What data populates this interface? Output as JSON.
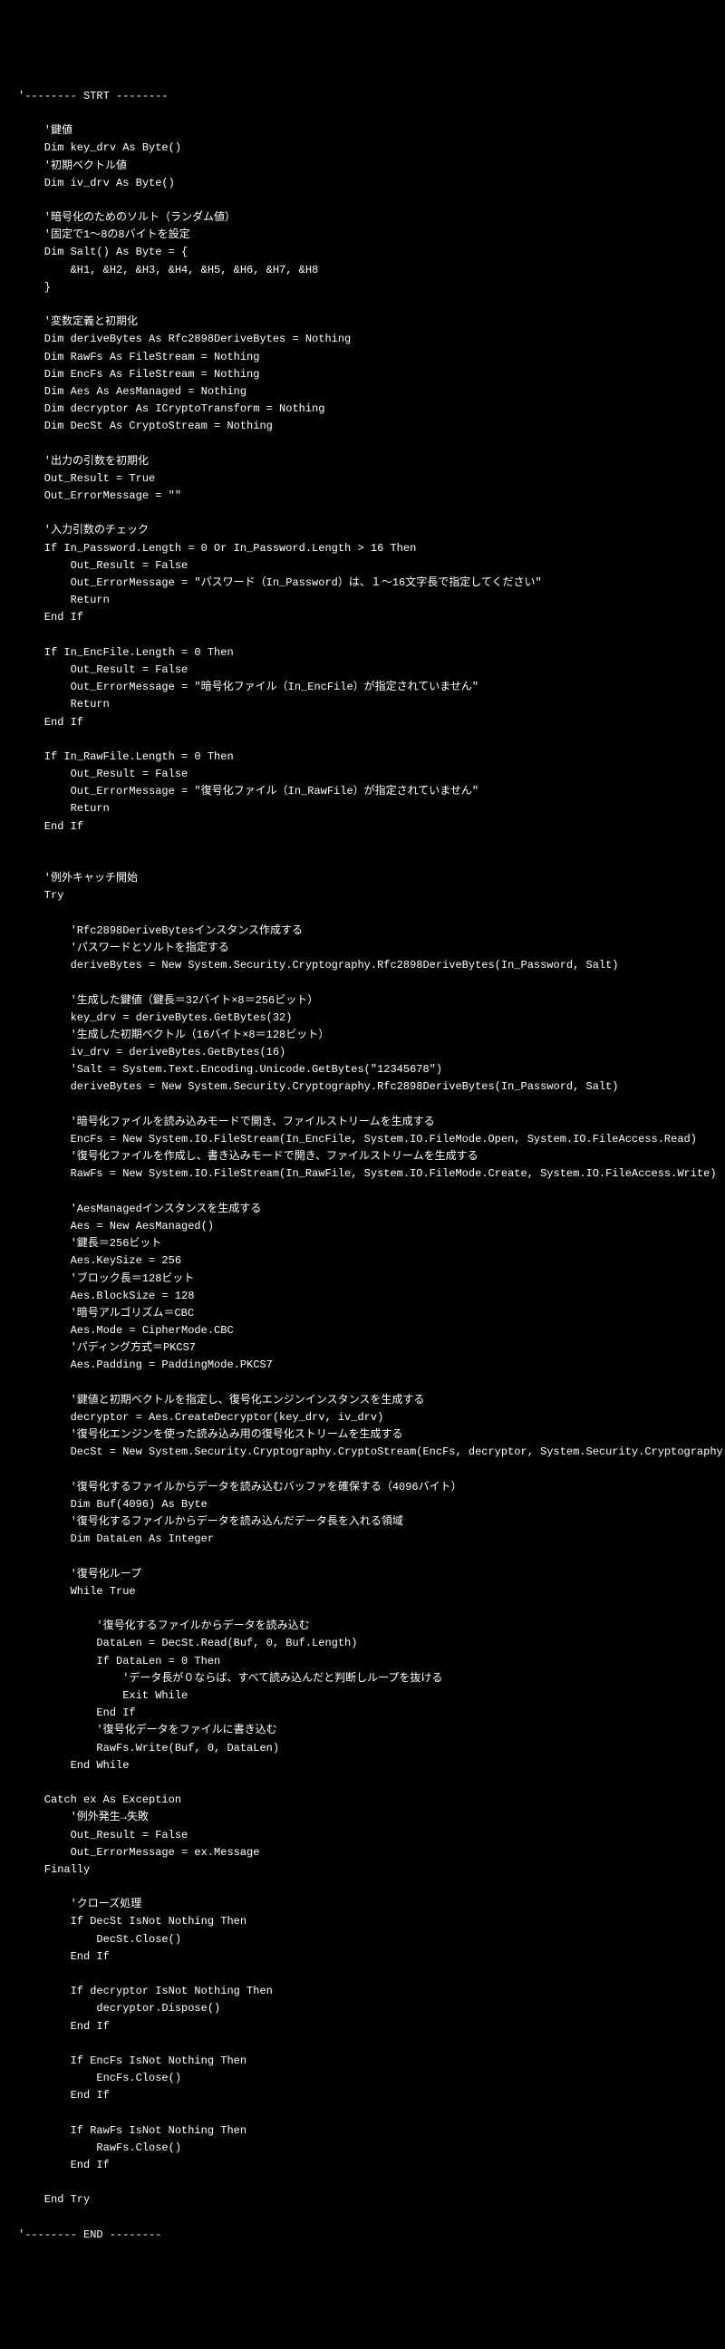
{
  "code": {
    "lines": [
      "'-------- STRT --------",
      "",
      "    '鍵値",
      "    Dim key_drv As Byte()",
      "    '初期ベクトル値",
      "    Dim iv_drv As Byte()",
      "",
      "    '暗号化のためのソルト（ランダム値）",
      "    '固定で1～8の8バイトを設定",
      "    Dim Salt() As Byte = {",
      "        &H1, &H2, &H3, &H4, &H5, &H6, &H7, &H8",
      "    }",
      "",
      "    '変数定義と初期化",
      "    Dim deriveBytes As Rfc2898DeriveBytes = Nothing",
      "    Dim RawFs As FileStream = Nothing",
      "    Dim EncFs As FileStream = Nothing",
      "    Dim Aes As AesManaged = Nothing",
      "    Dim decryptor As ICryptoTransform = Nothing",
      "    Dim DecSt As CryptoStream = Nothing",
      "",
      "    '出力の引数を初期化",
      "    Out_Result = True",
      "    Out_ErrorMessage = \"\"",
      "",
      "    '入力引数のチェック",
      "    If In_Password.Length = 0 Or In_Password.Length > 16 Then",
      "        Out_Result = False",
      "        Out_ErrorMessage = \"パスワード（In_Password）は、１～16文字長で指定してください\"",
      "        Return",
      "    End If",
      "",
      "    If In_EncFile.Length = 0 Then",
      "        Out_Result = False",
      "        Out_ErrorMessage = \"暗号化ファイル（In_EncFile）が指定されていません\"",
      "        Return",
      "    End If",
      "",
      "    If In_RawFile.Length = 0 Then",
      "        Out_Result = False",
      "        Out_ErrorMessage = \"復号化ファイル（In_RawFile）が指定されていません\"",
      "        Return",
      "    End If",
      "",
      "",
      "    '例外キャッチ開始",
      "    Try",
      "",
      "        'Rfc2898DeriveBytesインスタンス作成する",
      "        'パスワードとソルトを指定する",
      "        deriveBytes = New System.Security.Cryptography.Rfc2898DeriveBytes(In_Password, Salt)",
      "",
      "        '生成した鍵値（鍵長＝32バイト×8＝256ビット）",
      "        key_drv = deriveBytes.GetBytes(32)",
      "        '生成した初期ベクトル（16バイト×8＝128ビット）",
      "        iv_drv = deriveBytes.GetBytes(16)",
      "        'Salt = System.Text.Encoding.Unicode.GetBytes(\"12345678\")",
      "        deriveBytes = New System.Security.Cryptography.Rfc2898DeriveBytes(In_Password, Salt)",
      "",
      "        '暗号化ファイルを読み込みモードで開き、ファイルストリームを生成する",
      "        EncFs = New System.IO.FileStream(In_EncFile, System.IO.FileMode.Open, System.IO.FileAccess.Read)",
      "        '復号化ファイルを作成し、書き込みモードで開き、ファイルストリームを生成する",
      "        RawFs = New System.IO.FileStream(In_RawFile, System.IO.FileMode.Create, System.IO.FileAccess.Write)",
      "",
      "        'AesManagedインスタンスを生成する",
      "        Aes = New AesManaged()",
      "        '鍵長＝256ビット",
      "        Aes.KeySize = 256",
      "        'ブロック長＝128ビット",
      "        Aes.BlockSize = 128",
      "        '暗号アルゴリズム＝CBC",
      "        Aes.Mode = CipherMode.CBC",
      "        'パディング方式＝PKCS7",
      "        Aes.Padding = PaddingMode.PKCS7",
      "",
      "        '鍵値と初期ベクトルを指定し、復号化エンジンインスタンスを生成する",
      "        decryptor = Aes.CreateDecryptor(key_drv, iv_drv)",
      "        '復号化エンジンを使った読み込み用の復号化ストリームを生成する",
      "        DecSt = New System.Security.Cryptography.CryptoStream(EncFs, decryptor, System.Security.Cryptography.CryptoStreamMode.Read)",
      "",
      "        '復号化するファイルからデータを読み込むバッファを確保する（4096バイト）",
      "        Dim Buf(4096) As Byte",
      "        '復号化するファイルからデータを読み込んだデータ長を入れる領域",
      "        Dim DataLen As Integer",
      "",
      "        '復号化ループ",
      "        While True",
      "",
      "            '復号化するファイルからデータを読み込む",
      "            DataLen = DecSt.Read(Buf, 0, Buf.Length)",
      "            If DataLen = 0 Then",
      "                'データ長が０ならば、すべて読み込んだと判断しループを抜ける",
      "                Exit While",
      "            End If",
      "            '復号化データをファイルに書き込む",
      "            RawFs.Write(Buf, 0, DataLen)",
      "        End While",
      "",
      "    Catch ex As Exception",
      "        '例外発生→失敗",
      "        Out_Result = False",
      "        Out_ErrorMessage = ex.Message",
      "    Finally",
      "",
      "        'クローズ処理",
      "        If DecSt IsNot Nothing Then",
      "            DecSt.Close()",
      "        End If",
      "",
      "        If decryptor IsNot Nothing Then",
      "            decryptor.Dispose()",
      "        End If",
      "",
      "        If EncFs IsNot Nothing Then",
      "            EncFs.Close()",
      "        End If",
      "",
      "        If RawFs IsNot Nothing Then",
      "            RawFs.Close()",
      "        End If",
      "",
      "    End Try",
      "",
      "'-------- END --------"
    ]
  }
}
